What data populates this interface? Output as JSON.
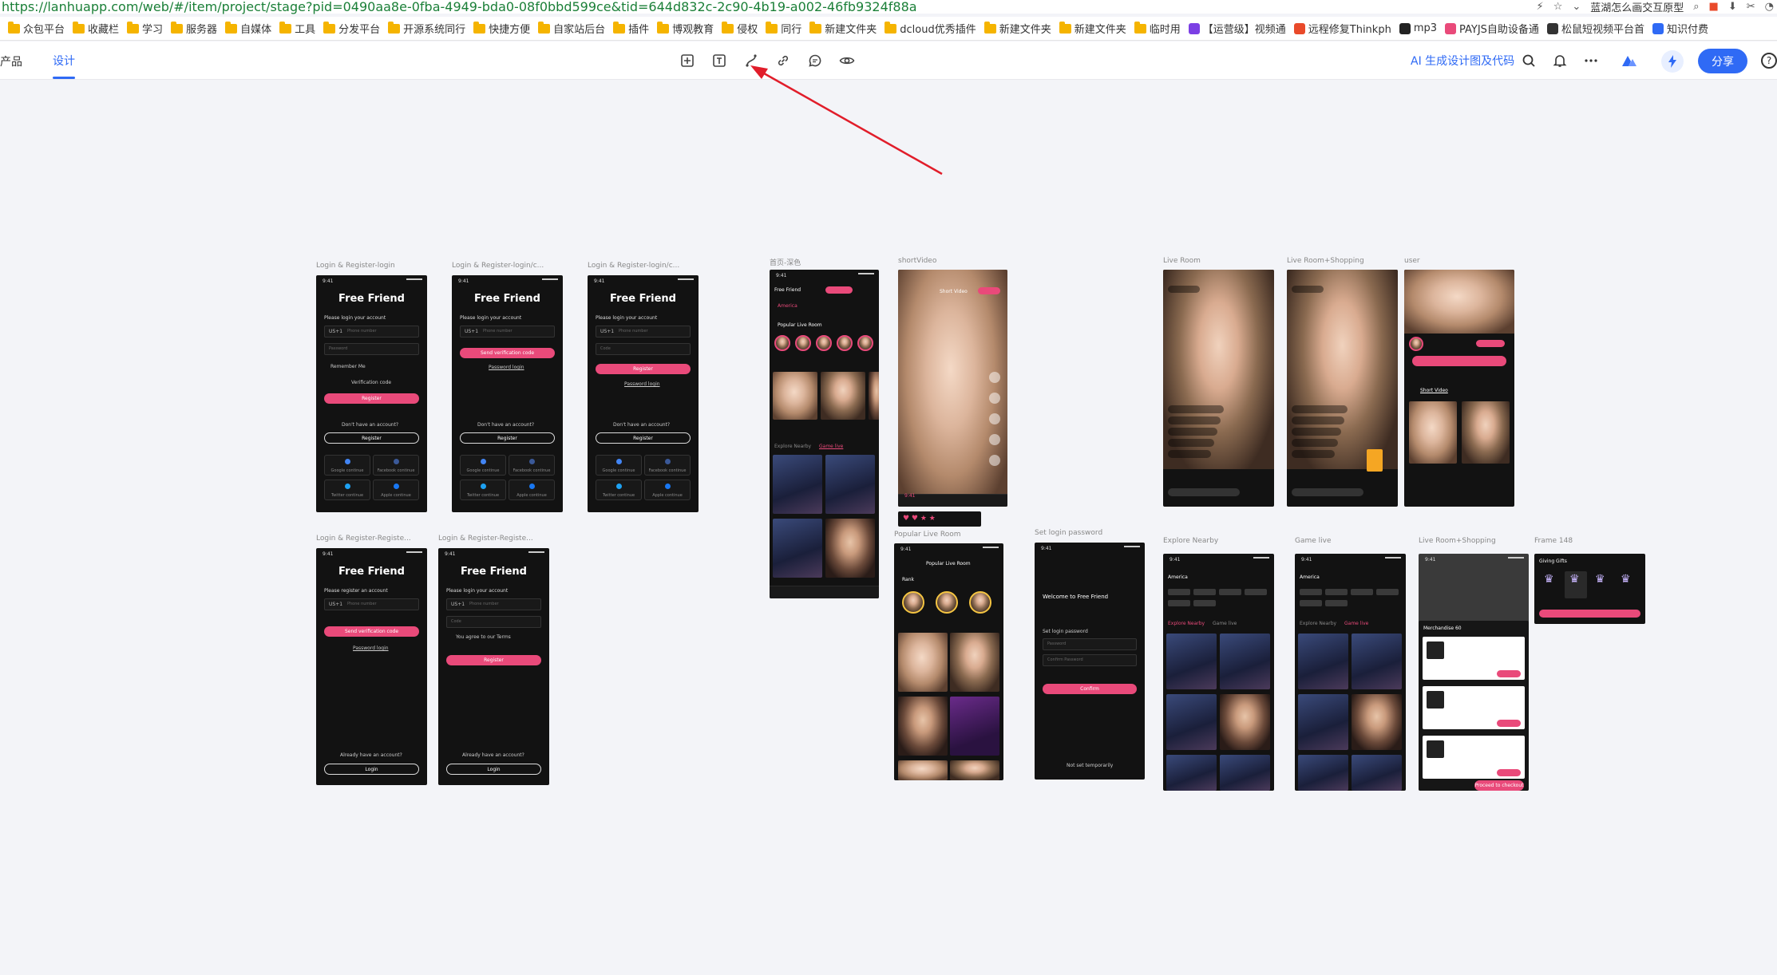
{
  "browser": {
    "url": "https://lanhuapp.com/web/#/item/project/stage?pid=0490aa8e-0fba-4949-bda0-08f0bbd599ce&tid=644d832c-2c90-4b19-a002-46fb9324f88a",
    "right_text": "蓝湖怎么画交互原型"
  },
  "bookmarks": [
    {
      "label": "众包平台",
      "icon": "folder-icon"
    },
    {
      "label": "收藏栏",
      "icon": "folder-icon"
    },
    {
      "label": "学习",
      "icon": "folder-icon"
    },
    {
      "label": "服务器",
      "icon": "folder-icon"
    },
    {
      "label": "自媒体",
      "icon": "folder-icon"
    },
    {
      "label": "工具",
      "icon": "folder-icon"
    },
    {
      "label": "分发平台",
      "icon": "folder-icon"
    },
    {
      "label": "开源系统同行",
      "icon": "folder-icon"
    },
    {
      "label": "快捷方便",
      "icon": "folder-icon"
    },
    {
      "label": "自家站后台",
      "icon": "folder-icon"
    },
    {
      "label": "插件",
      "icon": "folder-icon"
    },
    {
      "label": "博观教育",
      "icon": "folder-icon"
    },
    {
      "label": "侵权",
      "icon": "folder-icon"
    },
    {
      "label": "同行",
      "icon": "folder-icon"
    },
    {
      "label": "新建文件夹",
      "icon": "folder-icon"
    },
    {
      "label": "dcloud优秀插件",
      "icon": "folder-icon"
    },
    {
      "label": "新建文件夹",
      "icon": "folder-icon"
    },
    {
      "label": "新建文件夹",
      "icon": "folder-icon"
    },
    {
      "label": "临时用",
      "icon": "folder-icon"
    },
    {
      "label": "【运营级】视频通",
      "icon": "site-icon"
    },
    {
      "label": "远程修复Thinkph",
      "icon": "site-icon"
    },
    {
      "label": "mp3",
      "icon": "site-icon"
    },
    {
      "label": "PAYJS自助设备通",
      "icon": "site-icon"
    },
    {
      "label": "松鼠短视频平台首",
      "icon": "site-icon"
    },
    {
      "label": "知识付费",
      "icon": "site-icon"
    }
  ],
  "topbar": {
    "product_tab": "产品",
    "design_tab": "设计",
    "ai_link": "AI 生成设计图及代码",
    "share_label": "分享",
    "help_label": "?"
  },
  "artboards": [
    {
      "label": "Login & Register-login"
    },
    {
      "label": "Login & Register-login/c..."
    },
    {
      "label": "Login & Register-login/c..."
    },
    {
      "label": "Login & Register-Registe..."
    },
    {
      "label": "Login & Register-Registe..."
    },
    {
      "label": "首页-深色"
    },
    {
      "label": "shortVideo"
    },
    {
      "label": "Popular Live Room"
    },
    {
      "label": "Set login password"
    },
    {
      "label": "Live Room"
    },
    {
      "label": "Live Room+Shopping"
    },
    {
      "label": "user"
    },
    {
      "label": "Explore Nearby"
    },
    {
      "label": "Game live"
    },
    {
      "label": "Live Room+Shopping"
    },
    {
      "label": "Frame 148"
    }
  ],
  "mock": {
    "time": "9:41",
    "app_title": "Free Friend",
    "please_login": "Please login your account",
    "please_register": "Please register an account",
    "country_code": "US+1",
    "phone_ph": "Phone number",
    "password_ph": "Password",
    "code_ph": "Code",
    "remember": "Remember Me",
    "verification": "Verification code",
    "register": "Register",
    "no_account": "Don't have an account?",
    "send_code": "Send verification code",
    "password_login": "Password login",
    "google": "Google continue",
    "facebook": "Facebook continue",
    "twitter": "Twitter continue",
    "apple": "Apple continue",
    "agree_terms": "You agree to our Terms",
    "already": "Already have an account?",
    "login": "Login",
    "welcome": "Welcome to Free Friend",
    "set_password": "Set login password",
    "confirm_ph": "Confirm Password",
    "confirm": "Confirm",
    "not_set": "Not set temporarily",
    "popular_live": "Popular Live Room",
    "rank": "Rank",
    "explore": "Explore Nearby",
    "game_live": "Game live",
    "america": "America",
    "merchandise": "Merchandise 60",
    "proceed": "Proceed to checkout",
    "giving_gifts": "Giving Gifts",
    "short_video": "Short Video"
  },
  "colors": {
    "accent": "#2f6af5",
    "pink": "#e94a7a",
    "frame_bg": "#121212",
    "canvas_bg": "#f3f4f8",
    "arrow": "#e11d2a"
  }
}
